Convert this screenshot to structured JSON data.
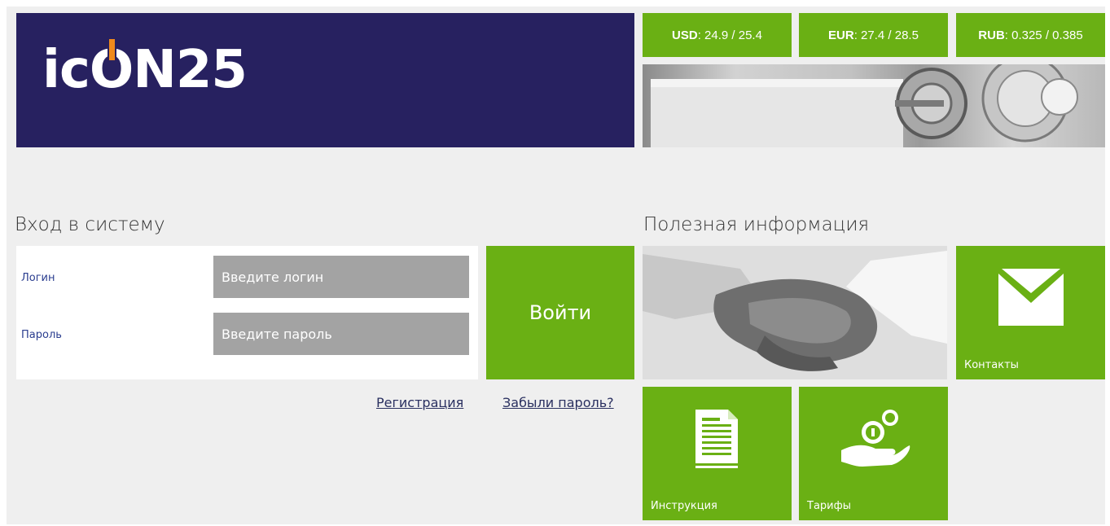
{
  "header": {
    "logo": {
      "text_before": "ic",
      "text_o": "O",
      "text_after": "N25"
    },
    "rates": [
      {
        "code": "USD",
        "value": ": 24.9 / 25.4"
      },
      {
        "code": "EUR",
        "value": ": 27.4 / 28.5"
      },
      {
        "code": "RUB",
        "value": ": 0.325 / 0.385"
      }
    ]
  },
  "login": {
    "title": "Вход в систему",
    "login_label": "Логин",
    "login_placeholder": "Введите логин",
    "password_label": "Пароль",
    "password_placeholder": "Введите пароль",
    "submit_label": "Войти",
    "register_link": "Регистрация",
    "forgot_link": "Забыли пароль?"
  },
  "info": {
    "title": "Полезная информация",
    "tiles": {
      "contacts": "Контакты",
      "instructions": "Инструкция",
      "tariffs": "Тарифы"
    }
  },
  "colors": {
    "brand_navy": "#272160",
    "accent_green": "#6ab014",
    "accent_orange": "#f08a1c",
    "input_gray": "#a3a3a3"
  }
}
